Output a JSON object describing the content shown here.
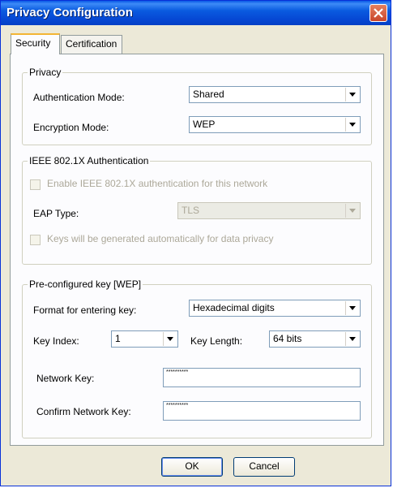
{
  "window": {
    "title": "Privacy Configuration"
  },
  "tabs": [
    {
      "label": "Security",
      "active": true
    },
    {
      "label": "Certification",
      "active": false
    }
  ],
  "privacy": {
    "legend": "Privacy",
    "auth_mode_label": "Authentication Mode:",
    "auth_mode_value": "Shared",
    "enc_mode_label": "Encryption Mode:",
    "enc_mode_value": "WEP"
  },
  "ieee": {
    "legend": "IEEE 802.1X Authentication",
    "enable_label": "Enable IEEE 802.1X authentication for this network",
    "enable_checked": false,
    "eap_label": "EAP Type:",
    "eap_value": "TLS",
    "keys_label": "Keys will be generated automatically for data privacy",
    "keys_checked": false
  },
  "wep": {
    "legend": "Pre-configured key [WEP]",
    "format_label": "Format for entering key:",
    "format_value": "Hexadecimal digits",
    "key_index_label": "Key Index:",
    "key_index_value": "1",
    "key_length_label": "Key Length:",
    "key_length_value": "64 bits",
    "network_key_label": "Network Key:",
    "network_key_value": "**********",
    "confirm_key_label": "Confirm Network Key:",
    "confirm_key_value": "**********"
  },
  "buttons": {
    "ok": "OK",
    "cancel": "Cancel"
  },
  "icons": {
    "close": "close-icon",
    "dropdown": "chevron-down-icon"
  }
}
